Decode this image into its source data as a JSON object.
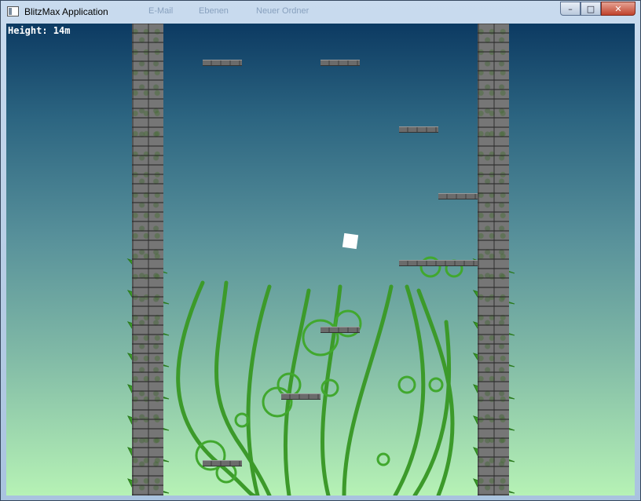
{
  "window": {
    "title": "BlitzMax Application",
    "background_taskbar_labels": [
      "E-Mail",
      "Ebenen",
      "Neuer Ordner"
    ],
    "buttons": {
      "minimize": "–",
      "maximize": "□",
      "close": "✕"
    }
  },
  "hud": {
    "height_text": "Height: 14m"
  },
  "colors": {
    "sky_top": "#0c3a62",
    "sky_bottom": "#b6f2b5",
    "vine": "#3c9a2a",
    "stone": "#767676",
    "player": "#ffffff"
  },
  "icons": [
    "app-window-icon",
    "minimize-icon",
    "maximize-icon",
    "close-icon"
  ]
}
